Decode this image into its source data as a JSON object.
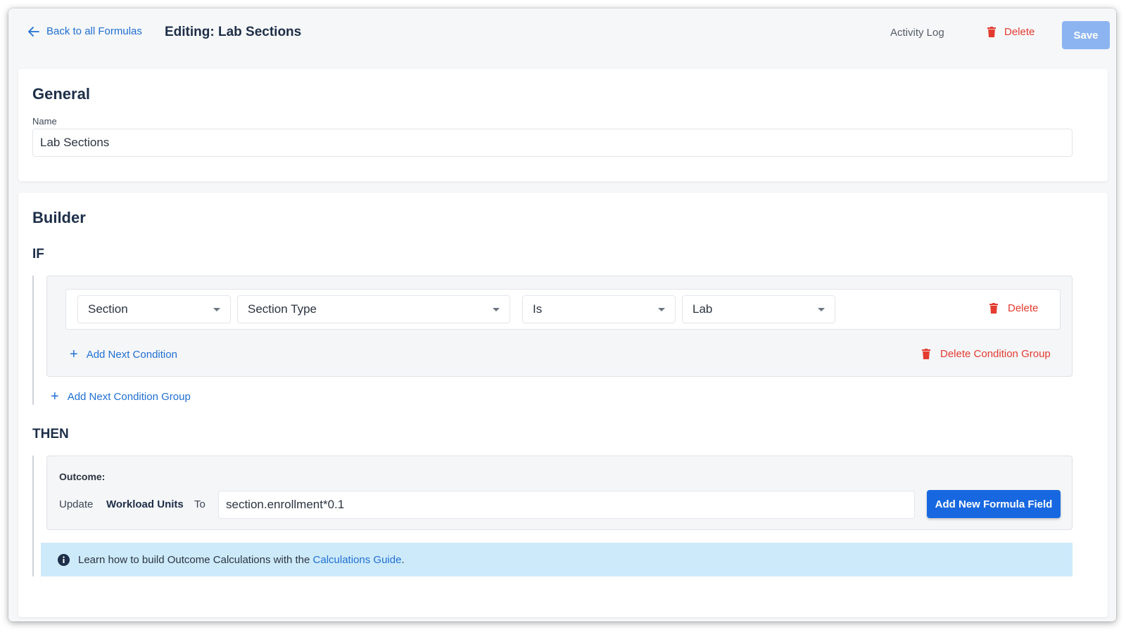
{
  "header": {
    "back_label": "Back to all Formulas",
    "editing_title": "Editing: Lab Sections",
    "activity_log_label": "Activity Log",
    "delete_label": "Delete",
    "save_label": "Save"
  },
  "general": {
    "title": "General",
    "name_label": "Name",
    "name_value": "Lab Sections"
  },
  "builder": {
    "title": "Builder",
    "if_label": "IF",
    "condition": {
      "entity": "Section",
      "field": "Section Type",
      "operator": "Is",
      "value": "Lab",
      "delete_label": "Delete"
    },
    "add_condition_label": "Add Next Condition",
    "delete_group_label": "Delete Condition Group",
    "add_group_label": "Add Next Condition Group",
    "then_label": "THEN",
    "outcome": {
      "label": "Outcome:",
      "update_label": "Update",
      "target_field": "Workload Units",
      "to_label": "To",
      "formula_value": "section.enrollment*0.1",
      "add_formula_label": "Add New Formula Field"
    },
    "info": {
      "text": "Learn how to build Outcome Calculations with the",
      "link_label": "Calculations Guide",
      "suffix": "."
    }
  },
  "colors": {
    "primary": "#1768e0",
    "link": "#1f6fd1",
    "danger": "#e33b2f",
    "save_disabled": "#8cb4f0",
    "info_bg": "#cdeafb"
  }
}
